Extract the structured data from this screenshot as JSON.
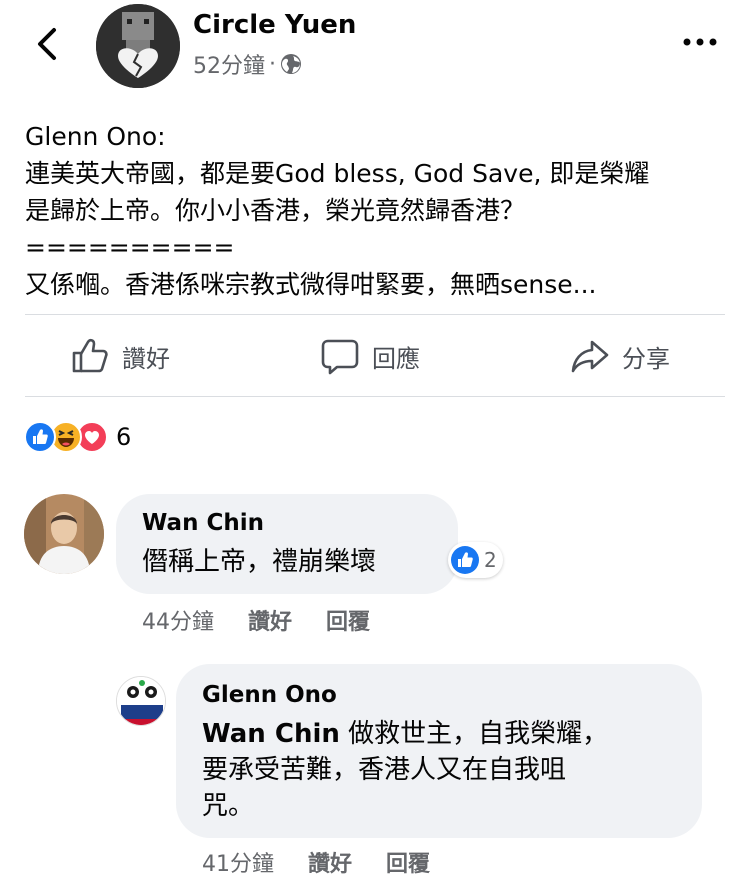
{
  "header": {
    "author": "Circle Yuen",
    "time": "52分鐘",
    "separator": "·",
    "icons": {
      "back": "chevron-left-icon",
      "privacy": "globe-icon",
      "more": "more-horizontal-icon"
    }
  },
  "post": {
    "lines": [
      "Glenn Ono:",
      "連美英大帝國，都是要God bless, God Save, 即是榮耀",
      "是歸於上帝。你小小香港，榮光竟然歸香港？",
      "==========",
      "又係嗰。香港係咪宗教式微得咁緊要，無晒sense..."
    ]
  },
  "actions": {
    "like": "讚好",
    "comment": "回應",
    "share": "分享"
  },
  "reactions": {
    "types": [
      "like",
      "haha",
      "love"
    ],
    "count": "6",
    "colors": {
      "like": "#1877f2",
      "haha": "#f7b125",
      "love": "#f33e58"
    }
  },
  "comments": [
    {
      "name": "Wan Chin",
      "text": "僭稱上帝，禮崩樂壞",
      "like_count": "2",
      "time": "44分鐘",
      "like_label": "讚好",
      "reply_label": "回覆"
    },
    {
      "name": "Glenn Ono",
      "mention": "Wan Chin",
      "text_line1": " 做救世主，自我榮耀，",
      "text_line2": "要承受苦難，香港人又在自我咀",
      "text_line3": "咒。",
      "time": "41分鐘",
      "like_label": "讚好",
      "reply_label": "回覆"
    }
  ]
}
